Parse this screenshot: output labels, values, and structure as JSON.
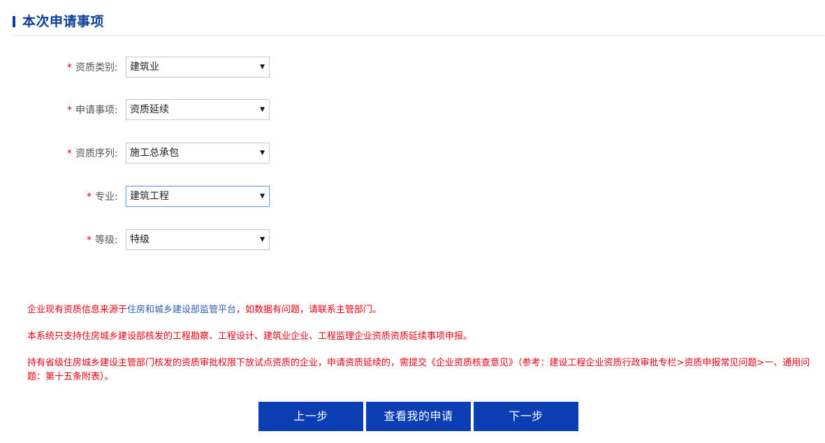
{
  "section": {
    "title": "本次申请事项"
  },
  "form": {
    "required_mark": "*",
    "fields": [
      {
        "label": "资质类别:",
        "value": "建筑业"
      },
      {
        "label": "申请事项:",
        "value": "资质延续"
      },
      {
        "label": "资质序列:",
        "value": "施工总承包"
      },
      {
        "label": "专业:",
        "value": "建筑工程"
      },
      {
        "label": "等级:",
        "value": "特级"
      }
    ]
  },
  "notes": {
    "note1_prefix": "企业现有资质信息来源于",
    "note1_link": "住房和城乡建设部监管平台",
    "note1_suffix": "，如数据有问题，请联系主管部门。",
    "note2": "本系统只支持住房城乡建设部核发的工程勘察、工程设计、建筑业企业、工程监理企业资质资质延续事项申报。",
    "note3": "持有省级住房城乡建设主管部门核发的资质审批权限下放试点资质的企业，申请资质延续的，需提交《企业资质核查意见》（参考：建设工程企业资质行政审批专栏>资质申报常见问题>一、通用问题：第十五条附表）。"
  },
  "buttons": {
    "prev": "上一步",
    "my_applications": "查看我的申请",
    "next": "下一步"
  },
  "icons": {
    "dropdown_arrow": "▼"
  },
  "colors": {
    "brand_blue": "#0b3db3",
    "title_blue": "#0b3d9c",
    "warning_red": "#e60012",
    "link_blue": "#2b5fb4"
  }
}
